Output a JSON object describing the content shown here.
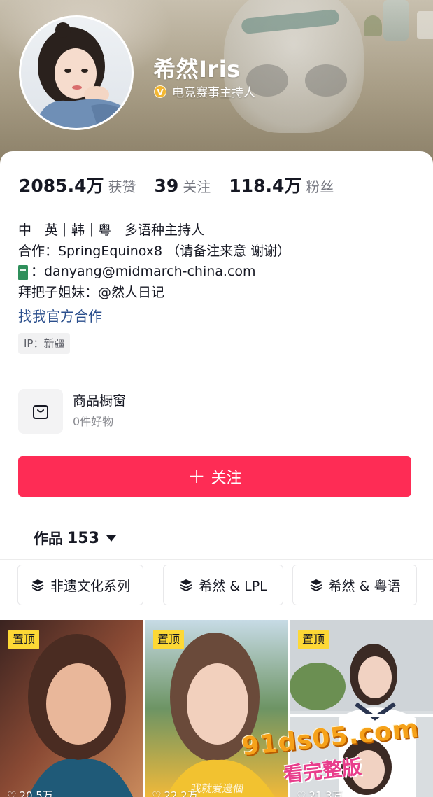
{
  "profile": {
    "nickname": "希然Iris",
    "verified_title": "电竞赛事主持人",
    "verified_badge": "V"
  },
  "stats": [
    {
      "value": "2085.4万",
      "label": "获赞"
    },
    {
      "value": "39",
      "label": "关注"
    },
    {
      "value": "118.4万",
      "label": "粉丝"
    }
  ],
  "bio": {
    "line1": "中｜英｜韩｜粤｜多语种主持人",
    "line2": "合作：SpringEquinox8 （请备注来意 谢谢）",
    "line3_text": "：danyang@midmarch-china.com",
    "line4": "拜把子姐妹：@然人日记"
  },
  "official_link": "找我官方合作",
  "ip_tag": "IP：新疆",
  "shop": {
    "title": "商品橱窗",
    "subtitle": "0件好物",
    "icon": "shopping-bag-icon"
  },
  "follow_button": {
    "label": "关注",
    "icon": "plus-icon"
  },
  "works": {
    "label": "作品",
    "count": "153"
  },
  "collections": [
    {
      "label": "非遗文化系列",
      "icon": "layers-icon"
    },
    {
      "label": "希然 & LPL",
      "icon": "layers-icon"
    },
    {
      "label": "希然 & 粤语",
      "icon": "layers-icon"
    }
  ],
  "videos": [
    {
      "pinned_label": "置顶",
      "plays": "20.5万"
    },
    {
      "pinned_label": "置顶",
      "plays": "22.2万",
      "overlay_text": "我就爱邊個"
    },
    {
      "pinned_label": "置顶",
      "plays": "21.3万"
    }
  ],
  "watermark": {
    "main": "91ds05.com",
    "sub": "看完整版"
  },
  "colors": {
    "accent": "#fe2c55",
    "link": "#2a4e8c",
    "pin_badge": "#fdd835",
    "verify_badge": "#f2b632"
  }
}
